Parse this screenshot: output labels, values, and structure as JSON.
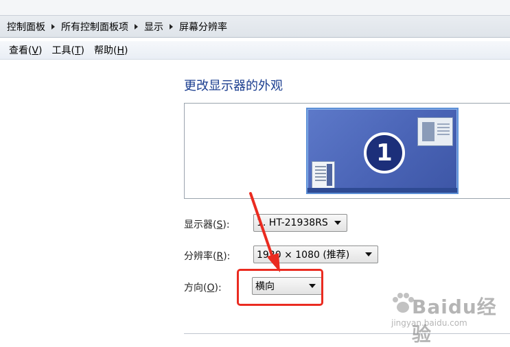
{
  "breadcrumb": {
    "items": [
      "控制面板",
      "所有控制面板项",
      "显示",
      "屏幕分辨率"
    ]
  },
  "menubar": {
    "items": [
      {
        "pre": "查看(",
        "key": "V",
        "post": ")"
      },
      {
        "pre": "工具(",
        "key": "T",
        "post": ")"
      },
      {
        "pre": "帮助(",
        "key": "H",
        "post": ")"
      }
    ]
  },
  "main": {
    "title": "更改显示器的外观",
    "monitor_number": "1",
    "display": {
      "label_pre": "显示器(",
      "label_key": "S",
      "label_post": "):",
      "value": "1. HT-21938RS"
    },
    "resolution": {
      "label_pre": "分辨率(",
      "label_key": "R",
      "label_post": "):",
      "value": "1920 × 1080 (推荐)"
    },
    "orientation": {
      "label_pre": "方向(",
      "label_key": "O",
      "label_post": "):",
      "value": "横向"
    }
  },
  "annotation": {
    "color": "#ea2b20"
  },
  "watermark": {
    "brand": "Baidu经验",
    "site": "jingyan.baidu.com"
  }
}
